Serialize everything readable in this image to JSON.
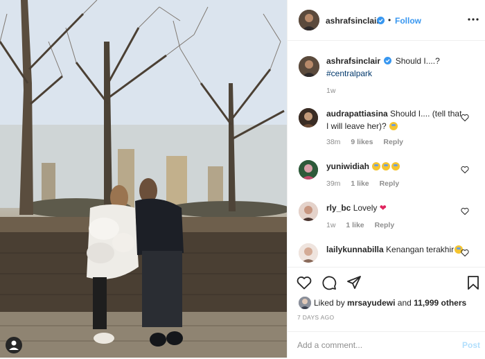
{
  "post": {
    "author": "ashrafsinclair",
    "follow_label": "Follow",
    "dot": "•",
    "caption": {
      "text": "Should I....?",
      "hashtag": "#centralpark",
      "time": "1w"
    },
    "comments": [
      {
        "user": "audrapattiasina",
        "text": "Should I.... (tell that I will leave her)?",
        "time": "38m",
        "likes": "9 likes",
        "reply": "Reply"
      },
      {
        "user": "yuniwidiah",
        "text": "",
        "time": "39m",
        "likes": "1 like",
        "reply": "Reply"
      },
      {
        "user": "rly_bc",
        "text": "Lovely",
        "time": "1w",
        "likes": "1 like",
        "reply": "Reply"
      },
      {
        "user": "lailykunnabilla",
        "text": "Kenangan terakhir",
        "time": "",
        "likes": "",
        "reply": ""
      }
    ],
    "likes": {
      "liked_by_label": "Liked by",
      "liker": "mrsayudewi",
      "and_label": "and",
      "others": "11,999 others"
    },
    "date": "7 DAYS AGO",
    "add_comment_placeholder": "Add a comment...",
    "post_label": "Post"
  },
  "icons": {
    "heart": "heart-icon",
    "comment": "comment-icon",
    "share": "share-icon",
    "save": "bookmark-icon",
    "more": "more-options-icon",
    "verified": "verified-badge-icon",
    "user_tag": "user-tag-icon"
  },
  "colors": {
    "link": "#3897f0",
    "text": "#262626",
    "muted": "#8e8e8e",
    "border": "#efefef"
  }
}
